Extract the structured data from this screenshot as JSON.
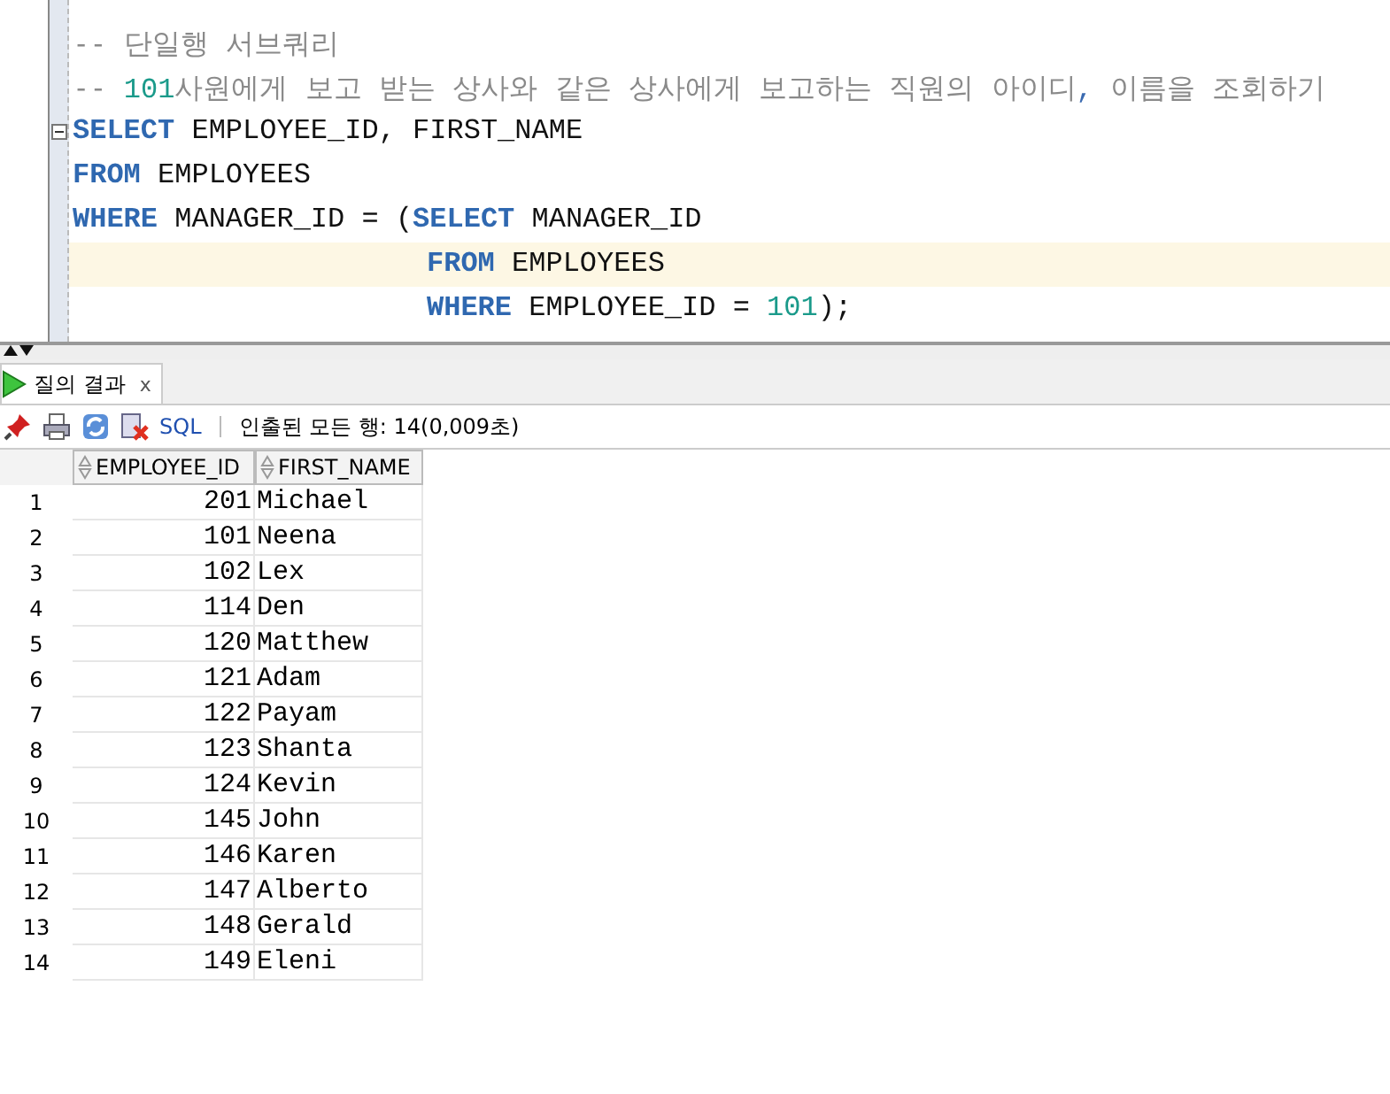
{
  "editor": {
    "lines": [
      {
        "current": false,
        "nested": false,
        "tokens": [
          {
            "kind": "comment",
            "text": "-- 단일행 서브쿼리"
          }
        ]
      },
      {
        "current": false,
        "nested": false,
        "tokens": [
          {
            "kind": "comment",
            "text": "-- "
          },
          {
            "kind": "number",
            "text": "101"
          },
          {
            "kind": "comment",
            "text": "사원에게 보고 받는 상사와 같은 상사에게 보고하는 직원의 아이디"
          },
          {
            "kind": "punct",
            "text": ","
          },
          {
            "kind": "comment",
            "text": " 이름을 조회하기"
          }
        ]
      },
      {
        "current": false,
        "nested": false,
        "fold": true,
        "tokens": [
          {
            "kind": "keyword",
            "text": "SELECT"
          },
          {
            "kind": "text",
            "text": " EMPLOYEE_ID, FIRST_NAME"
          }
        ]
      },
      {
        "current": false,
        "nested": false,
        "tokens": [
          {
            "kind": "keyword",
            "text": "FROM"
          },
          {
            "kind": "text",
            "text": " EMPLOYEES"
          }
        ]
      },
      {
        "current": false,
        "nested": false,
        "tokens": [
          {
            "kind": "keyword",
            "text": "WHERE"
          },
          {
            "kind": "text",
            "text": " MANAGER_ID = ("
          },
          {
            "kind": "keyword",
            "text": "SELECT"
          },
          {
            "kind": "text",
            "text": " MANAGER_ID"
          }
        ]
      },
      {
        "current": true,
        "nested": true,
        "tokens": [
          {
            "kind": "keyword",
            "text": "FROM"
          },
          {
            "kind": "text",
            "text": " EMPLOYEES"
          }
        ]
      },
      {
        "current": false,
        "nested": true,
        "tokens": [
          {
            "kind": "keyword",
            "text": "WHERE"
          },
          {
            "kind": "text",
            "text": " EMPLOYEE_ID = "
          },
          {
            "kind": "number",
            "text": "101"
          },
          {
            "kind": "text",
            "text": ");"
          }
        ]
      }
    ]
  },
  "result_tab": {
    "label": "질의 결과",
    "close": "x"
  },
  "toolbar": {
    "sql_link": "SQL",
    "status": "인출된 모든 행: 14(0,009초)"
  },
  "table": {
    "columns": [
      "EMPLOYEE_ID",
      "FIRST_NAME"
    ],
    "rows": [
      {
        "num": "1",
        "cells": [
          "201",
          "Michael"
        ]
      },
      {
        "num": "2",
        "cells": [
          "101",
          "Neena"
        ]
      },
      {
        "num": "3",
        "cells": [
          "102",
          "Lex"
        ]
      },
      {
        "num": "4",
        "cells": [
          "114",
          "Den"
        ]
      },
      {
        "num": "5",
        "cells": [
          "120",
          "Matthew"
        ]
      },
      {
        "num": "6",
        "cells": [
          "121",
          "Adam"
        ]
      },
      {
        "num": "7",
        "cells": [
          "122",
          "Payam"
        ]
      },
      {
        "num": "8",
        "cells": [
          "123",
          "Shanta"
        ]
      },
      {
        "num": "9",
        "cells": [
          "124",
          "Kevin"
        ]
      },
      {
        "num": "10",
        "cells": [
          "145",
          "John"
        ]
      },
      {
        "num": "11",
        "cells": [
          "146",
          "Karen"
        ]
      },
      {
        "num": "12",
        "cells": [
          "147",
          "Alberto"
        ]
      },
      {
        "num": "13",
        "cells": [
          "148",
          "Gerald"
        ]
      },
      {
        "num": "14",
        "cells": [
          "149",
          "Eleni"
        ]
      }
    ]
  }
}
